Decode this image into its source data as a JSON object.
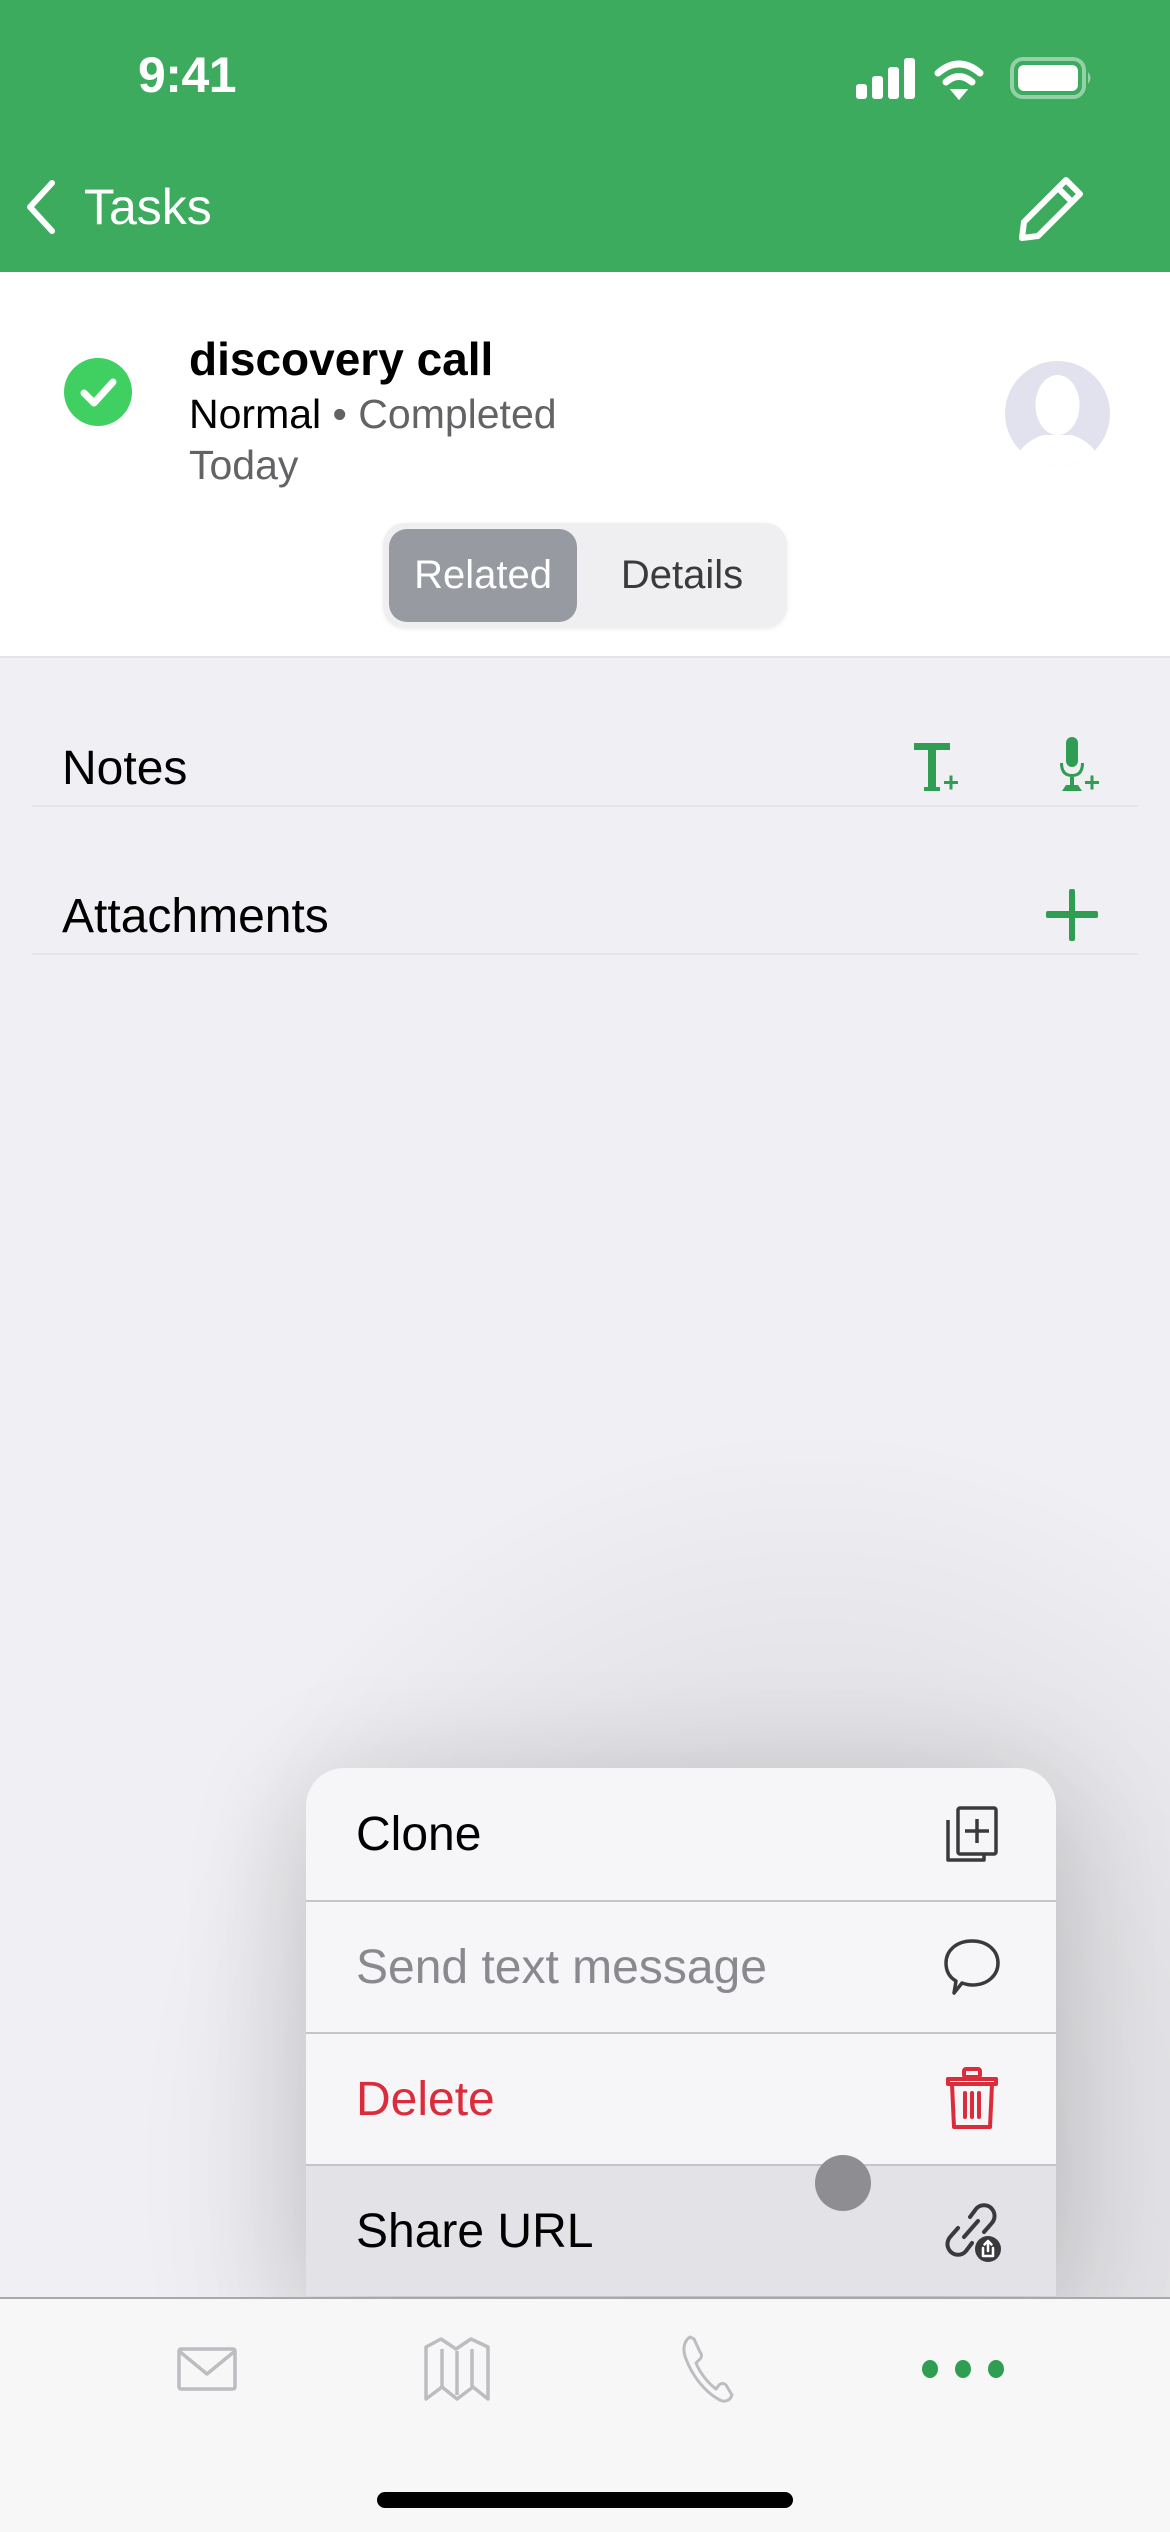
{
  "status_bar": {
    "time": "9:41",
    "icons": [
      "signal-icon",
      "wifi-icon",
      "battery-icon"
    ]
  },
  "nav": {
    "back_label": "Tasks",
    "back_icon": "chevron-left-icon",
    "edit_icon": "pencil-icon"
  },
  "task": {
    "title": "discovery call",
    "priority": "Normal",
    "separator": " • ",
    "status": "Completed",
    "date": "Today",
    "status_icon": "check-circle-icon",
    "avatar_icon": "person-placeholder-icon"
  },
  "segments": {
    "items": [
      {
        "label": "Related",
        "selected": true
      },
      {
        "label": "Details",
        "selected": false
      }
    ]
  },
  "sections": [
    {
      "label": "Notes",
      "actions": [
        "add-text-note-icon",
        "add-voice-note-icon"
      ]
    },
    {
      "label": "Attachments",
      "actions": [
        "plus-icon"
      ]
    }
  ],
  "context_menu": {
    "items": [
      {
        "label": "Clone",
        "icon": "clone-icon",
        "state": "normal"
      },
      {
        "label": "Send text message",
        "icon": "speech-bubble-icon",
        "state": "disabled"
      },
      {
        "label": "Delete",
        "icon": "trash-icon",
        "state": "destructive"
      },
      {
        "label": "Share URL",
        "icon": "share-link-icon",
        "state": "highlighted"
      }
    ]
  },
  "tab_bar": {
    "items": [
      {
        "icon": "mail-icon",
        "active": false
      },
      {
        "icon": "map-icon",
        "active": false
      },
      {
        "icon": "phone-icon",
        "active": false
      },
      {
        "icon": "more-icon",
        "active": true
      }
    ]
  },
  "colors": {
    "brand_green": "#3dab5e",
    "check_green": "#3fd061",
    "action_green": "#2f9e53",
    "destructive_red": "#da2c3b",
    "inactive_tab": "#bdbcc0"
  }
}
